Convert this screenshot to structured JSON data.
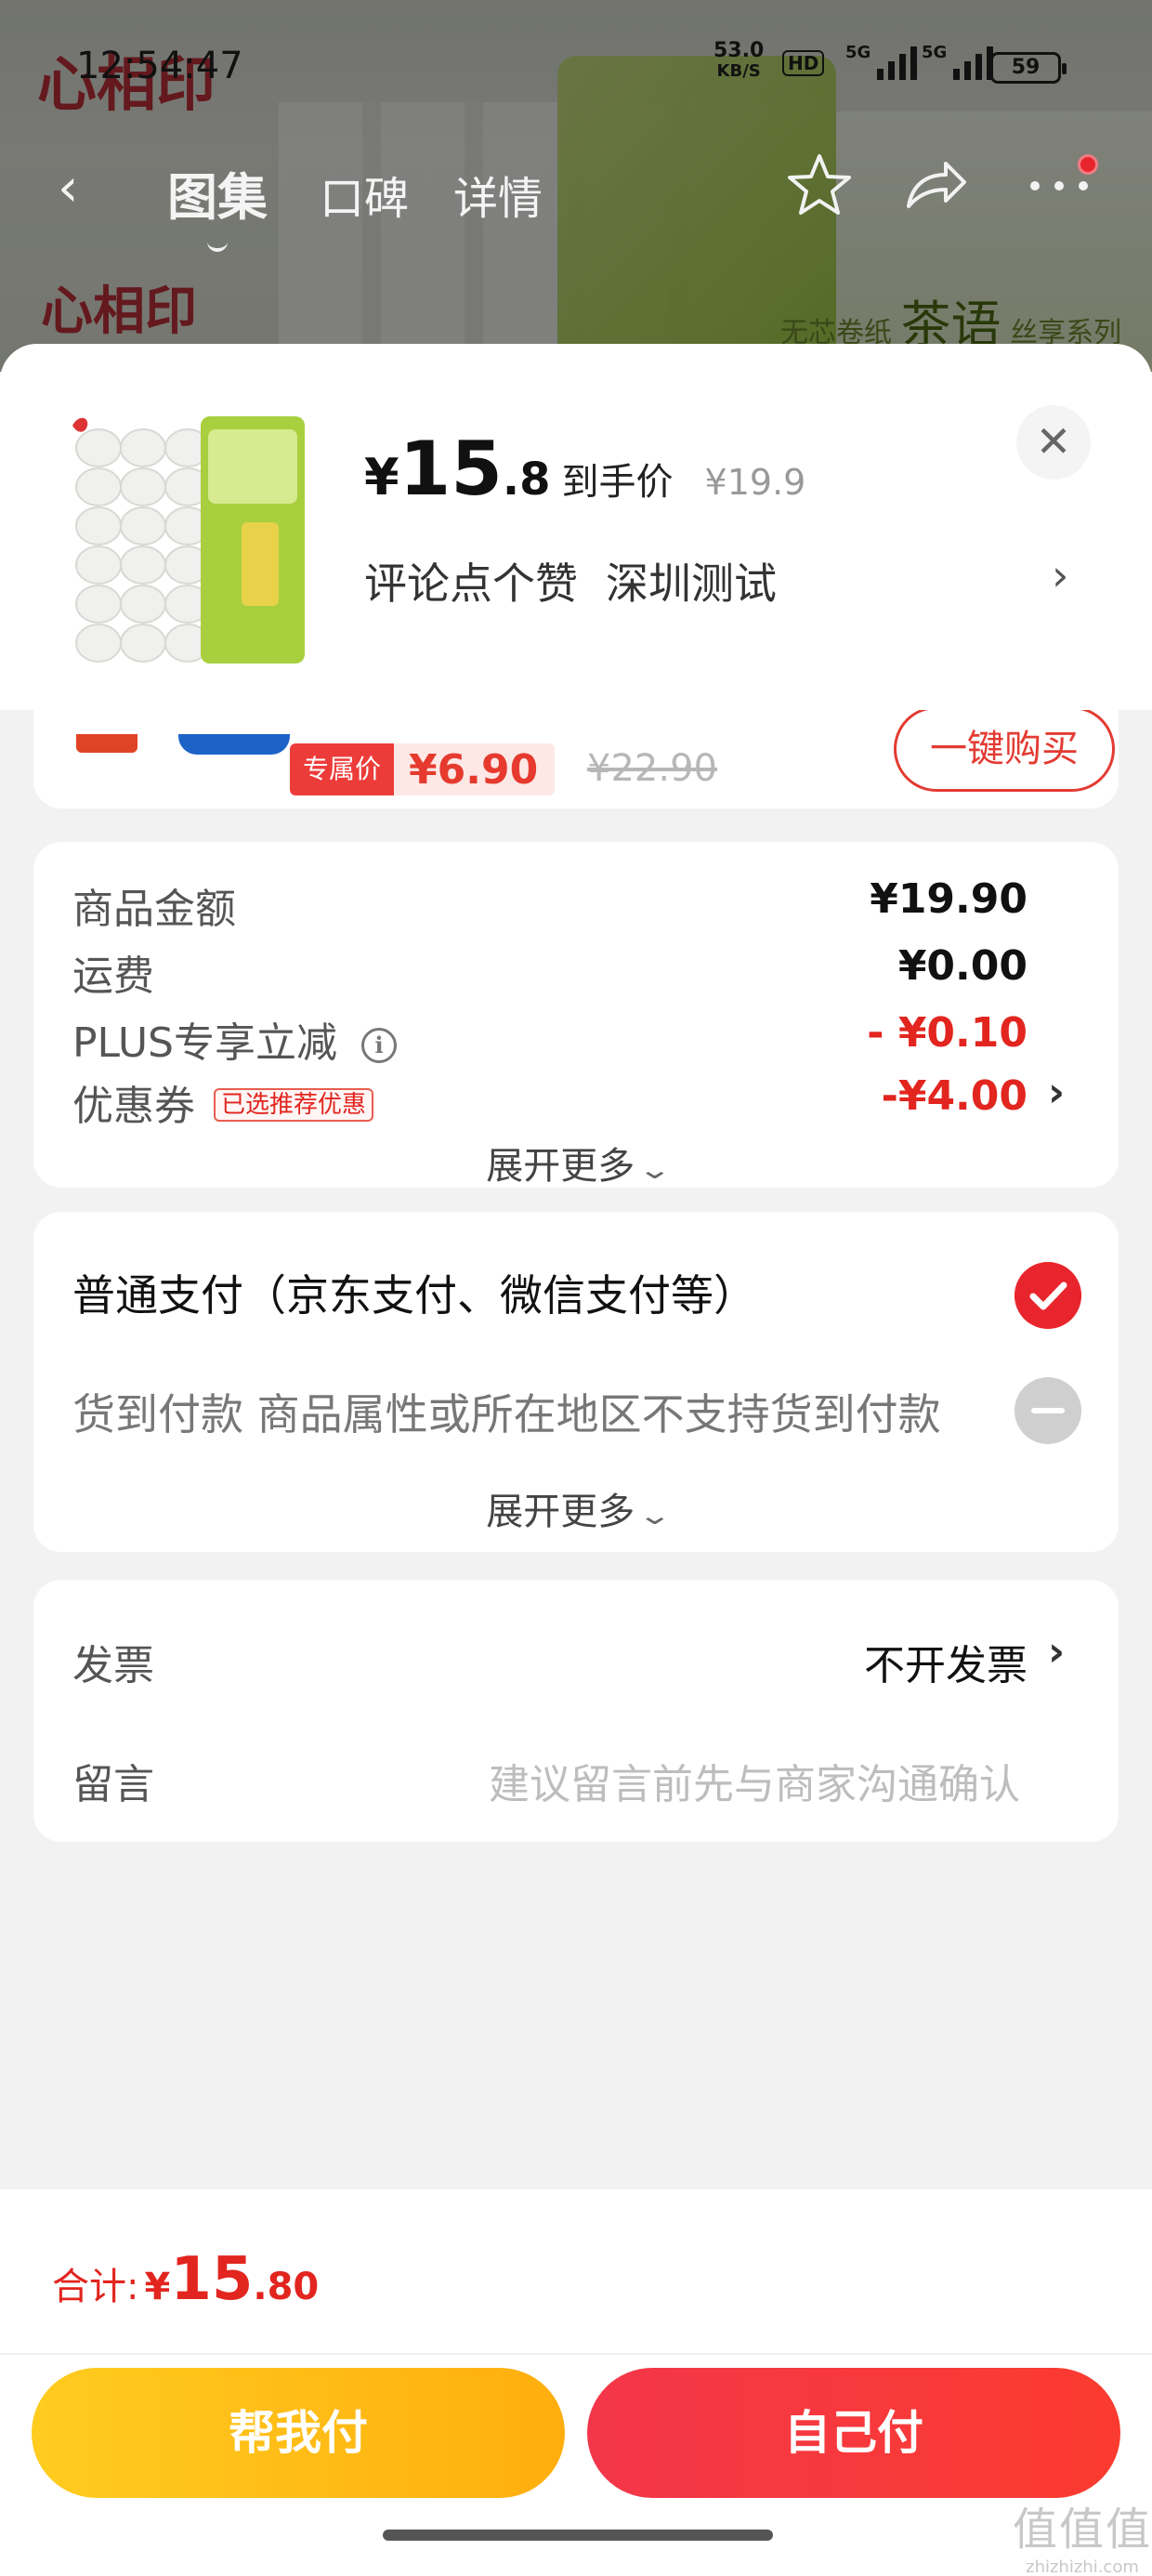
{
  "status_bar": {
    "time": "12:54:47",
    "net_speed_value": "53.0",
    "net_speed_unit": "KB/S",
    "hd_badge": "HD",
    "signal1_tag": "5G",
    "signal2_tag": "5G",
    "battery": "59"
  },
  "background": {
    "brand_logo": "心相印",
    "tagline_prefix": "无芯卷纸",
    "tagline_main": "茶语",
    "tagline_suffix": "丝享系列"
  },
  "nav": {
    "tabs": [
      {
        "label": "图集",
        "active": true
      },
      {
        "label": "口碑",
        "active": false
      },
      {
        "label": "详情",
        "active": false
      }
    ]
  },
  "header": {
    "price_symbol": "¥",
    "price_int": "15",
    "price_dec": ".8",
    "price_tag": "到手价",
    "original_price": "¥19.9",
    "address_part1": "评论点个赞",
    "address_part2": "深圳测试",
    "close_icon": "close-icon"
  },
  "recommend": {
    "badge": "专属价",
    "price": "¥6.90",
    "original_price": "¥22.90",
    "buy_button": "一键购买"
  },
  "summary": {
    "goods_amount_label": "商品金额",
    "goods_amount_value": "¥19.90",
    "shipping_label": "运费",
    "shipping_value": "¥0.00",
    "plus_label": "PLUS专享立减",
    "plus_value": "- ¥0.10",
    "coupon_label": "优惠券",
    "coupon_tag": "已选推荐优惠",
    "coupon_value": "-¥4.00",
    "expand_label": "展开更多"
  },
  "payment": {
    "normal_pay_label": "普通支付（京东支付、微信支付等）",
    "cod_label": "货到付款 商品属性或所在地区不支持货到付款",
    "expand_label": "展开更多"
  },
  "invoice": {
    "invoice_label": "发票",
    "invoice_value": "不开发票",
    "message_label": "留言",
    "message_placeholder": "建议留言前先与商家沟通确认"
  },
  "footer": {
    "total_label": "合计:",
    "total_symbol": "¥",
    "total_int": "15",
    "total_dec": ".80",
    "help_pay_button": "帮我付",
    "self_pay_button": "自己付",
    "watermark_main": "值值值",
    "watermark_sub": "zhizhizhi.com"
  },
  "colors": {
    "accent_red": "#e2251f",
    "help_button": "#ffb811",
    "self_button": "#f5383d"
  }
}
